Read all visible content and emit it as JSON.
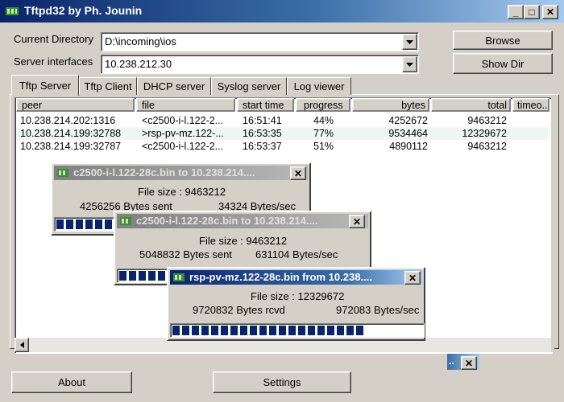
{
  "window": {
    "title": "Tftpd32 by Ph. Jounin"
  },
  "caption_buttons": {
    "minimize": "_",
    "maximize": "□",
    "close": "✕"
  },
  "form": {
    "current_directory_label": "Current Directory",
    "current_directory_value": "D:\\incoming\\ios",
    "server_interfaces_label": "Server interfaces",
    "server_interfaces_value": "10.238.212.30",
    "browse_label": "Browse",
    "showdir_label": "Show Dir"
  },
  "tabs": [
    {
      "label": "Tftp Server",
      "active": true
    },
    {
      "label": "Tftp Client",
      "active": false
    },
    {
      "label": "DHCP server",
      "active": false
    },
    {
      "label": "Syslog server",
      "active": false
    },
    {
      "label": "Log viewer",
      "active": false
    }
  ],
  "table": {
    "columns": [
      "peer",
      "file",
      "start time",
      "progress",
      "bytes",
      "total",
      "timeo.."
    ],
    "rows": [
      {
        "peer": "10.238.214.202:1316",
        "file": "<c2500-i-l.122-2...",
        "start_time": "16:51:41",
        "progress": "44%",
        "bytes": "4252672",
        "total": "9463212"
      },
      {
        "peer": "10.238.214.199:32788",
        "file": ">rsp-pv-mz.122-...",
        "start_time": "16:53:35",
        "progress": "77%",
        "bytes": "9534464",
        "total": "12329672"
      },
      {
        "peer": "10.238.214.199:32787",
        "file": "<c2500-i-l.122-2...",
        "start_time": "16:53:37",
        "progress": "51%",
        "bytes": "4890112",
        "total": "9463212"
      }
    ]
  },
  "popups": [
    {
      "title": "c2500-i-l.122-28c.bin to 10.238.214....",
      "file_size": "File size : 9463212",
      "bytes": "4256256 Bytes sent",
      "rate": "34324 Bytes/sec",
      "progress": 0.44,
      "active": false
    },
    {
      "title": "c2500-i-l.122-28c.bin to 10.238.214....",
      "file_size": "File size : 9463212",
      "bytes": "5048832 Bytes sent",
      "rate": "631104 Bytes/sec",
      "progress": 0.51,
      "active": false
    },
    {
      "title": "rsp-pv-mz.122-28c.bin from 10.238....",
      "file_size": "File size : 12329672",
      "bytes": "9720832 Bytes rcvd",
      "rate": "972083 Bytes/sec",
      "progress": 0.77,
      "active": true
    }
  ],
  "minimized_popup": {
    "title": "..",
    "close": "✕"
  },
  "bottom": {
    "about_label": "About",
    "settings_label": "Settings"
  },
  "colors": {
    "title_blue": "#0a246a",
    "progress_block": "#0a246a",
    "face": "#d4d0c8"
  },
  "icons": {
    "app": "tftp-app-icon",
    "dropdown": "chevron-down-icon",
    "close": "close-icon"
  }
}
